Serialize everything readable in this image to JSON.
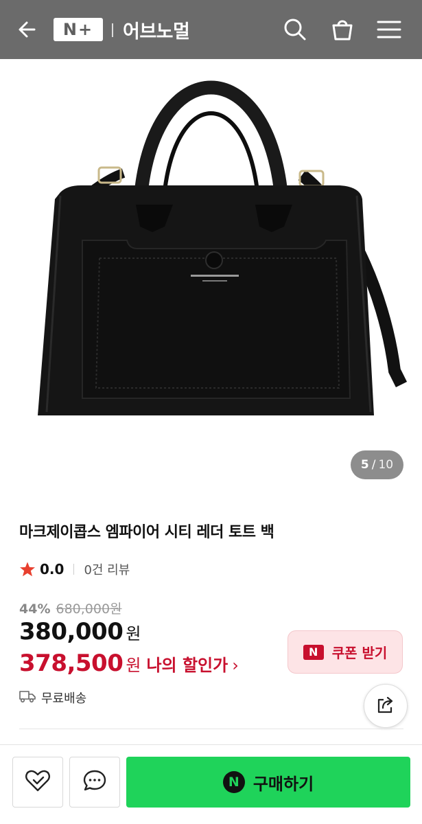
{
  "header": {
    "logo_text": "N+",
    "store_name": "어브노멀",
    "icons": [
      "back-arrow-icon",
      "search-icon",
      "shopping-bag-icon",
      "menu-icon"
    ]
  },
  "gallery": {
    "current": "5",
    "separator": "/",
    "total": "10"
  },
  "product": {
    "title": "마크제이콥스 엠파이어 시티 레더 토트 백",
    "rating": "0.0",
    "review_count": "0건 리뷰",
    "discount_rate": "44%",
    "original_price": "680,000원",
    "price": "380,000",
    "price_unit": "원",
    "my_price": "378,500",
    "my_price_unit": "원",
    "my_price_label": "나의 할인가",
    "my_price_chevron": "›",
    "shipping": "무료배송"
  },
  "coupon": {
    "badge": "N",
    "label": "쿠폰 받기"
  },
  "bottom_bar": {
    "buy_badge": "N",
    "buy_label": "구매하기"
  },
  "colors": {
    "header_bg": "#6b6b6b",
    "accent_red": "#c8102e",
    "buy_green": "#1fd35a",
    "star": "#e8402f"
  }
}
